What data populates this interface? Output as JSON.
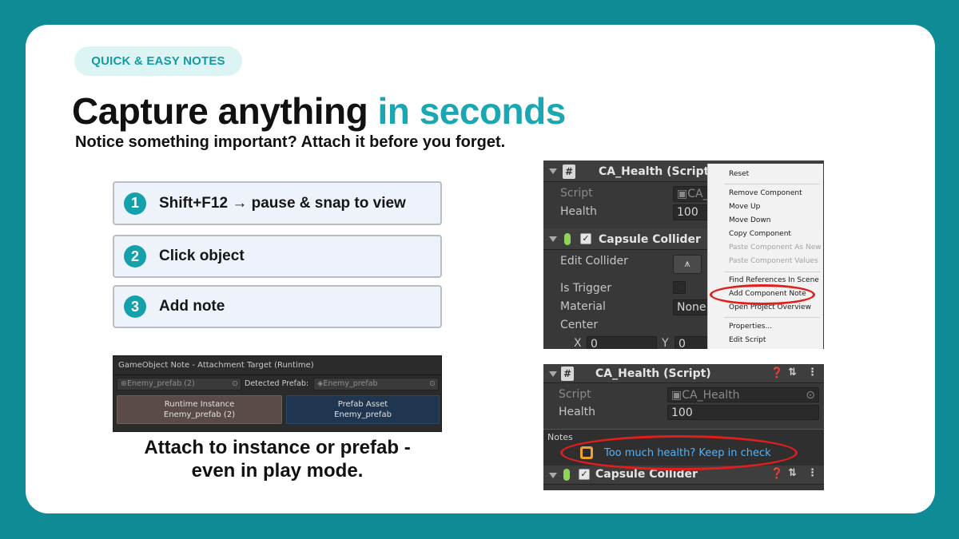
{
  "badge": "QUICK & EASY NOTES",
  "headline": {
    "main": "Capture anything",
    "accent": "in seconds"
  },
  "subhead": "Notice something important? Attach it before you forget.",
  "steps": [
    {
      "num": "1",
      "text": "Shift+F12 → pause & snap to view"
    },
    {
      "num": "2",
      "text": "Click object"
    },
    {
      "num": "3",
      "text": "Add note"
    }
  ],
  "attach_panel": {
    "title": "GameObject Note - Attachment Target (Runtime)",
    "object_field": "Enemy_prefab (2)",
    "detected_label": "Detected Prefab:",
    "detected_field": "Enemy_prefab",
    "runtime_button": {
      "line1": "Runtime Instance",
      "line2": "Enemy_prefab (2)"
    },
    "prefab_button": {
      "line1": "Prefab Asset",
      "line2": "Enemy_prefab"
    }
  },
  "caption": {
    "line1": "Attach to instance or prefab -",
    "line2": "even in play mode."
  },
  "inspector_menu": {
    "component_title": "CA_Health (Script)",
    "script_label": "Script",
    "script_value": "CA_",
    "health_label": "Health",
    "health_value": "100",
    "collider_title": "Capsule Collider",
    "edit_collider_label": "Edit Collider",
    "is_trigger_label": "Is Trigger",
    "material_label": "Material",
    "material_value": "None",
    "center_label": "Center",
    "center_x_label": "X",
    "center_x_value": "0",
    "center_y_label": "Y",
    "center_y_value": "0",
    "menu_items": [
      {
        "label": "Reset",
        "disabled": false
      },
      {
        "label": "Remove Component",
        "disabled": false
      },
      {
        "label": "Move Up",
        "disabled": false
      },
      {
        "label": "Move Down",
        "disabled": false
      },
      {
        "label": "Copy Component",
        "disabled": false
      },
      {
        "label": "Paste Component As New",
        "disabled": true
      },
      {
        "label": "Paste Component Values",
        "disabled": true
      },
      {
        "label": "Find References In Scene",
        "disabled": false
      },
      {
        "label": "Add Component Note",
        "disabled": false
      },
      {
        "label": "Open Project Overview",
        "disabled": false
      },
      {
        "label": "Properties...",
        "disabled": false
      },
      {
        "label": "Edit Script",
        "disabled": false
      }
    ]
  },
  "inspector_notes": {
    "component_title": "CA_Health (Script)",
    "script_label": "Script",
    "script_value": "CA_Health",
    "health_label": "Health",
    "health_value": "100",
    "notes_label": "Notes",
    "note_text": "Too much health? Keep in check",
    "collider_title": "Capsule Collider"
  },
  "colors": {
    "background": "#0e8b95",
    "accent": "#1ba7b1",
    "highlight_ring": "#e01e1e"
  }
}
